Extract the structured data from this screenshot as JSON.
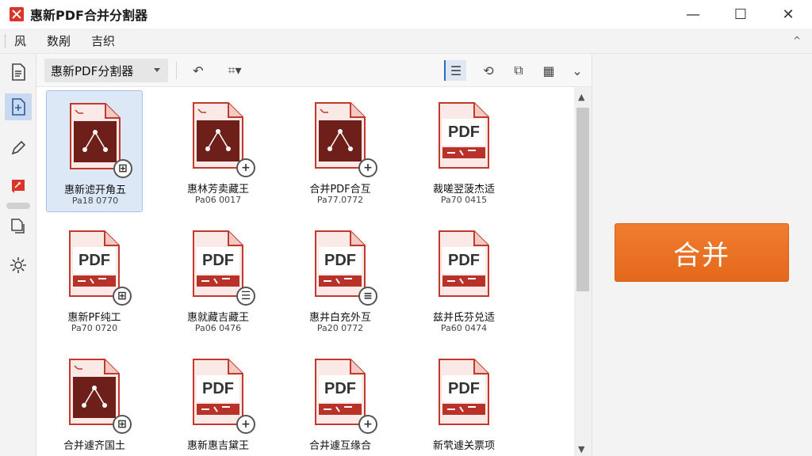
{
  "window": {
    "title": "惠新PDF合并分割器",
    "minimize": "—",
    "maximize": "☐",
    "close": "✕"
  },
  "menu": {
    "items": [
      "㶡",
      "数剐",
      "吉织"
    ],
    "collapse": "^"
  },
  "toolbar": {
    "mode_dropdown": "惠新PDF分割器",
    "undo_glyph": "↶",
    "crop_glyph": "⌗▾",
    "view_list_glyph": "☰",
    "rotate_glyph": "⟲",
    "preview_glyph": "⧉",
    "grid_glyph": "▦",
    "more_glyph": "⌄"
  },
  "files": [
    {
      "name": "惠新滤开角五",
      "pages": "Pa18 0770",
      "variant": "dark",
      "badge": "⊞",
      "selected": true
    },
    {
      "name": "惠林芳卖藏王",
      "pages": "Pa06 0017",
      "variant": "dark2",
      "badge": "+",
      "selected": false
    },
    {
      "name": "合并PDF合互",
      "pages": "Pa77.0772",
      "variant": "dark",
      "badge": "+",
      "selected": false
    },
    {
      "name": "裁嗟翌菠杰适",
      "pages": "Pa70 0415",
      "variant": "pdf",
      "badge": "",
      "selected": false
    },
    {
      "name": "惠新PF纯工",
      "pages": "Pa70 0720",
      "variant": "pdf",
      "badge": "⊞",
      "selected": false
    },
    {
      "name": "惠就藏吉藏王",
      "pages": "Pa06 0476",
      "variant": "pdf",
      "badge": "☰",
      "selected": false
    },
    {
      "name": "惠井白充外互",
      "pages": "Pa20 0772",
      "variant": "pdf",
      "badge": "≡",
      "selected": false
    },
    {
      "name": "兹并氐芬兑适",
      "pages": "Pa60 0474",
      "variant": "pdf",
      "badge": "",
      "selected": false
    },
    {
      "name": "合并遽齐国土",
      "pages": "",
      "variant": "dark",
      "badge": "⊞",
      "selected": false
    },
    {
      "name": "惠新惠吉黛王",
      "pages": "",
      "variant": "pdf",
      "badge": "+",
      "selected": false
    },
    {
      "name": "合井遽互缘合",
      "pages": "",
      "variant": "pdf",
      "badge": "+",
      "selected": false
    },
    {
      "name": "新茕遽关票项",
      "pages": "",
      "variant": "pdf",
      "badge": "",
      "selected": false
    }
  ],
  "pdf_label": "PDF",
  "scroll": {
    "up": "▲",
    "down": "▼"
  },
  "merge_button": "合并",
  "colors": {
    "accent_orange": "#e96f22",
    "pdf_red": "#b8322a",
    "selection_blue": "#dde8f7"
  }
}
